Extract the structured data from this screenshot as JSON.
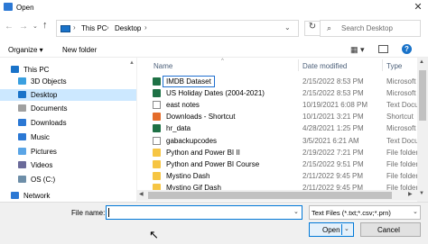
{
  "window": {
    "title": "Open",
    "close_glyph": "✕"
  },
  "nav": {
    "back": "←",
    "forward": "→",
    "recent": "⌄",
    "up": "↑"
  },
  "address": {
    "crumbs": [
      "This PC",
      "Desktop"
    ],
    "sep": "›",
    "dropdown": "⌄",
    "refresh": "↻"
  },
  "search": {
    "placeholder": "Search Desktop",
    "icon": "⌕"
  },
  "toolbar": {
    "organize": "Organize ▾",
    "new_folder": "New folder",
    "view": "▦ ▾",
    "help": "?"
  },
  "sidebar": {
    "items": [
      {
        "label": "This PC",
        "icon": "pc-icon",
        "color": "#1a73c9"
      },
      {
        "label": "3D Objects",
        "icon": "cube-icon",
        "color": "#3aa0e0"
      },
      {
        "label": "Desktop",
        "icon": "desktop-icon",
        "color": "#1a73c9",
        "selected": true
      },
      {
        "label": "Documents",
        "icon": "documents-icon",
        "color": "#a0a0a0"
      },
      {
        "label": "Downloads",
        "icon": "download-icon",
        "color": "#2b78d4"
      },
      {
        "label": "Music",
        "icon": "music-icon",
        "color": "#2b78d4"
      },
      {
        "label": "Pictures",
        "icon": "pictures-icon",
        "color": "#5aa5e6"
      },
      {
        "label": "Videos",
        "icon": "videos-icon",
        "color": "#6b6b9a"
      },
      {
        "label": "OS (C:)",
        "icon": "drive-icon",
        "color": "#6d8ea8"
      },
      {
        "label": "Network",
        "icon": "network-icon",
        "color": "#2b78d4"
      }
    ]
  },
  "columns": {
    "name": "Name",
    "date": "Date modified",
    "type": "Type",
    "sort_glyph": "^"
  },
  "files": [
    {
      "name": "IMDB Dataset",
      "date": "2/15/2022 8:53 PM",
      "type": "Microsoft E",
      "icon": "xls",
      "highlight": true
    },
    {
      "name": "US Holiday Dates (2004-2021)",
      "date": "2/15/2022 8:53 PM",
      "type": "Microsoft E",
      "icon": "xls"
    },
    {
      "name": "east notes",
      "date": "10/19/2021 6:08 PM",
      "type": "Text Docum",
      "icon": "doc"
    },
    {
      "name": "Downloads - Shortcut",
      "date": "10/1/2021 3:21 PM",
      "type": "Shortcut",
      "icon": "shortcut"
    },
    {
      "name": "hr_data",
      "date": "4/28/2021 1:25 PM",
      "type": "Microsoft E",
      "icon": "xls"
    },
    {
      "name": "gabackupcodes",
      "date": "3/5/2021 6:21 AM",
      "type": "Text Docum",
      "icon": "doc"
    },
    {
      "name": "Python and Power BI II",
      "date": "2/19/2022 7:21 PM",
      "type": "File folder",
      "icon": "folder"
    },
    {
      "name": "Python and Power BI Course",
      "date": "2/15/2022 9:51 PM",
      "type": "File folder",
      "icon": "folder"
    },
    {
      "name": "Mystino Dash",
      "date": "2/11/2022 9:45 PM",
      "type": "File folder",
      "icon": "folder"
    },
    {
      "name": "Mystino Gif Dash",
      "date": "2/11/2022 9:45 PM",
      "type": "File folder",
      "icon": "folder"
    }
  ],
  "bottom": {
    "file_name_label": "File name:",
    "file_name_value": "",
    "file_type": "Text Files (*.txt;*.csv;*.prn)",
    "open": "Open",
    "cancel": "Cancel",
    "dd": "⌄"
  },
  "scroll": {
    "up": "▲",
    "down": "▼",
    "left": "◀",
    "right": "▶"
  },
  "cursor": "↖"
}
